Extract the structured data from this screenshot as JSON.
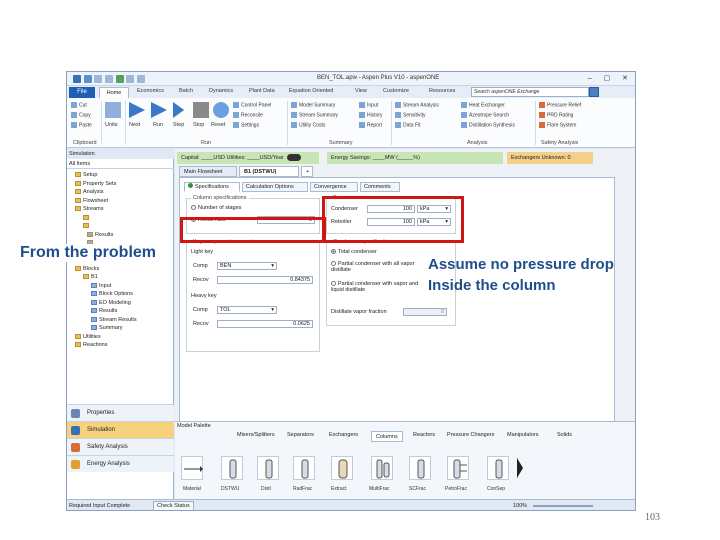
{
  "window": {
    "title": "BEN_TOL.apw - Aspen Plus V10 - aspenONE"
  },
  "ribbon": {
    "tabs": [
      "File",
      "Home",
      "Economics",
      "Batch",
      "Dynamics",
      "Plant Data",
      "Equation Oriented",
      "View",
      "Customize",
      "Resources"
    ],
    "search_placeholder": "Search aspenONE Exchange",
    "clipboard": {
      "cut": "Cut",
      "copy": "Copy",
      "paste": "Paste",
      "label": "Clipboard"
    },
    "units": {
      "label": "Units"
    },
    "run": {
      "buttons": [
        "Next",
        "Run",
        "Step",
        "Stop",
        "Reset"
      ],
      "control_panel": "Control Panel",
      "reconcile": "Reconcile",
      "settings": "Settings",
      "label": "Run"
    },
    "summary": {
      "model_summary": "Model Summary",
      "stream_summary": "Stream Summary",
      "utility_costs": "Utility Costs",
      "input": "Input",
      "history": "History",
      "report": "Report",
      "label": "Summary"
    },
    "analysis": {
      "stream_analysis": "Stream Analysis",
      "sensitivity": "Sensitivity",
      "data_fit": "Data Fit",
      "heat_exchanger": "Heat Exchanger",
      "azeotrope_search": "Azeotrope Search",
      "distillation_synthesis": "Distillation Synthesis",
      "label": "Analysis"
    },
    "safety": {
      "pressure_relief": "Pressure Relief",
      "prd_rating": "PRD Rating",
      "flare_system": "Flare System",
      "label": "Safety Analysis"
    }
  },
  "navigator": {
    "header": "Simulation",
    "all_items": "All Items",
    "tree": [
      "Setup",
      "Property Sets",
      "Analysis",
      "Flowsheet",
      "Streams",
      "Blocks",
      "B1",
      "Input",
      "Block Options",
      "EO Modeling",
      "Results",
      "Stream Results",
      "Summary",
      "Utilities",
      "Reactions"
    ],
    "buttons": [
      "Properties",
      "Simulation",
      "Safety Analysis",
      "Energy Analysis"
    ]
  },
  "env_bar": {
    "capital": "Capital: ____USD  Utilities: ____USD/Year",
    "energy": "Energy Savings: ____MW  (_____%)",
    "exchangers": "Exchangers  Unknown: 0"
  },
  "doc_tabs": [
    "Main Flowsheet",
    "B1 (DSTWU)",
    "+"
  ],
  "form": {
    "subtabs": [
      "Specifications",
      "Calculation Options",
      "Convergence",
      "Comments"
    ],
    "column_specs": {
      "title": "Column specifications",
      "number_of_stages": "Number of stages",
      "reflux_ratio": "Reflux ratio",
      "reflux_value": "3"
    },
    "pressure": {
      "title": "Pressure",
      "condenser": "Condenser",
      "condenser_value": "100",
      "condenser_unit": "kPa",
      "reboiler": "Reboiler",
      "reboiler_value": "100",
      "reboiler_unit": "kPa"
    },
    "key_recoveries": {
      "title": "Key component recoveries",
      "light_key": "Light key",
      "comp": "Comp",
      "light_comp": "BEN",
      "recov": "Recov",
      "light_recov": "0.84375",
      "heavy_key": "Heavy key",
      "heavy_comp": "TOL",
      "heavy_recov": "0.0625"
    },
    "condenser_specs": {
      "title": "Condenser specifications",
      "total": "Total condenser",
      "partial_vapor": "Partial condenser with all vapor distillate",
      "partial_both": "Partial condenser with vapor and liquid distillate",
      "distillate_vapor_fraction": "Distillate vapor fraction",
      "distillate_value": "0"
    }
  },
  "palette": {
    "title": "Model Palette",
    "tabs": [
      "Mixers/Splitters",
      "Separators",
      "Exchangers",
      "Columns",
      "Reactors",
      "Pressure Changers",
      "Manipulators",
      "Solids"
    ],
    "items": [
      "Material",
      "DSTWU",
      "Distl",
      "RadFrac",
      "Extract",
      "MultiFrac",
      "SCFrac",
      "PetroFrac",
      "ConSep"
    ]
  },
  "statusbar": {
    "left": "Required Input Complete",
    "check": "Check Status",
    "zoom": "100%"
  },
  "annotations": {
    "left": "From the problem",
    "right_line1": "Assume no pressure drop",
    "right_line2": "Inside the column"
  },
  "page_number": "103"
}
